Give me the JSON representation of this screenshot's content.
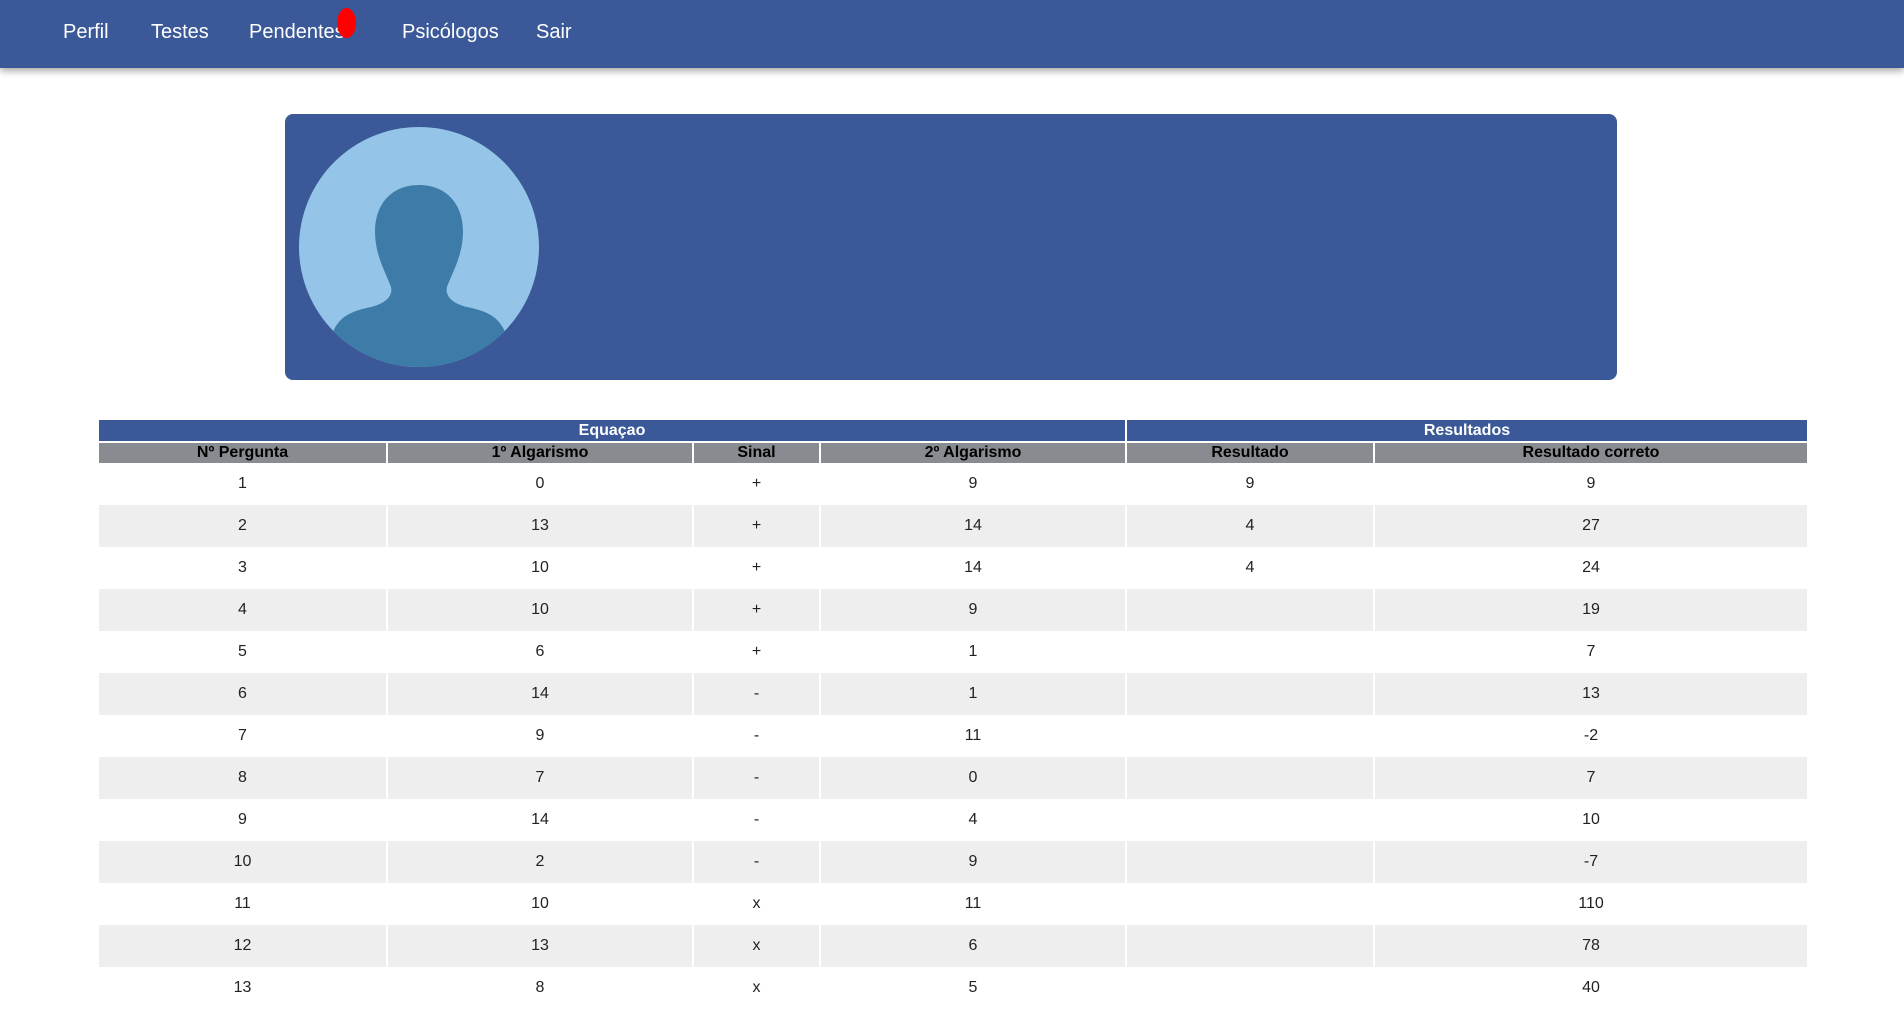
{
  "nav": {
    "items": [
      {
        "label": "Perfil"
      },
      {
        "label": "Testes"
      },
      {
        "label": "Pendentes"
      },
      {
        "label": "Psicólogos"
      },
      {
        "label": "Sair"
      }
    ],
    "notification_color": "#ff0000"
  },
  "colors": {
    "primary": "#3b5998",
    "header_gray": "#888b90",
    "avatar_bg": "#94c5e8",
    "avatar_fg": "#3d7ca8"
  },
  "profile": {
    "avatar_icon": "user-silhouette-icon"
  },
  "table": {
    "groups": [
      "Equaçao",
      "Resultados"
    ],
    "columns": [
      "Nº Pergunta",
      "1º Algarismo",
      "Sinal",
      "2º Algarismo",
      "Resultado",
      "Resultado correto"
    ],
    "rows": [
      [
        "1",
        "0",
        "+",
        "9",
        "9",
        "9"
      ],
      [
        "2",
        "13",
        "+",
        "14",
        "4",
        "27"
      ],
      [
        "3",
        "10",
        "+",
        "14",
        "4",
        "24"
      ],
      [
        "4",
        "10",
        "+",
        "9",
        "",
        "19"
      ],
      [
        "5",
        "6",
        "+",
        "1",
        "",
        "7"
      ],
      [
        "6",
        "14",
        "-",
        "1",
        "",
        "13"
      ],
      [
        "7",
        "9",
        "-",
        "11",
        "",
        "-2"
      ],
      [
        "8",
        "7",
        "-",
        "0",
        "",
        "7"
      ],
      [
        "9",
        "14",
        "-",
        "4",
        "",
        "10"
      ],
      [
        "10",
        "2",
        "-",
        "9",
        "",
        "-7"
      ],
      [
        "11",
        "10",
        "x",
        "11",
        "",
        "110"
      ],
      [
        "12",
        "13",
        "x",
        "6",
        "",
        "78"
      ],
      [
        "13",
        "8",
        "x",
        "5",
        "",
        "40"
      ]
    ]
  }
}
